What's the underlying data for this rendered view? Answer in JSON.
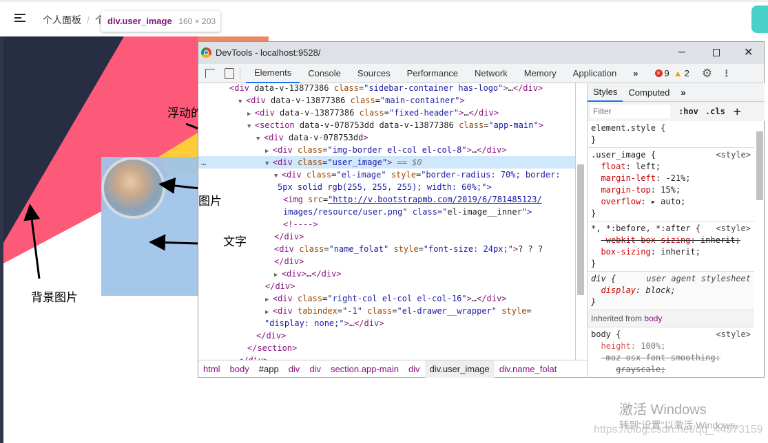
{
  "app": {
    "breadcrumb": [
      "个人面板",
      "个"
    ],
    "tooltip": {
      "selector": "div.user_image",
      "size": "160 × 203"
    }
  },
  "colors": {
    "navy": "#272d43",
    "pink": "#fd5a7a",
    "yellow": "#ffcb3b",
    "orange": "#e8896a",
    "highlight": "#a5c6e9",
    "teal": "#47d1c8"
  },
  "annotations": {
    "float_div": "浮动的div",
    "image": "图片",
    "text": "文字",
    "background": "背景图片"
  },
  "devtools": {
    "title": "DevTools - localhost:9528/",
    "tabs": [
      "Elements",
      "Console",
      "Sources",
      "Performance",
      "Network",
      "Memory",
      "Application"
    ],
    "more": "»",
    "errors": "9",
    "warnings": "2",
    "dom_lines": [
      {
        "indent": 0,
        "tri": "",
        "html": "<div data-v-13877386 class=\"sidebar-container has-logo\">…</div>"
      },
      {
        "indent": 1,
        "tri": "▼",
        "html": "<div data-v-13877386 class=\"main-container\">"
      },
      {
        "indent": 2,
        "tri": "▶",
        "html": "<div data-v-13877386 class=\"fixed-header\">…</div>"
      },
      {
        "indent": 2,
        "tri": "▼",
        "html": "<section data-v-078753dd data-v-13877386 class=\"app-main\">"
      },
      {
        "indent": 3,
        "tri": "▼",
        "html": "<div data-v-078753dd>"
      },
      {
        "indent": 4,
        "tri": "▶",
        "html": "<div class=\"img-border el-col el-col-8\">…</div>"
      },
      {
        "indent": 4,
        "tri": "▼",
        "html": "<div class=\"user_image\"> == $0",
        "selected": true
      },
      {
        "indent": 5,
        "tri": "▼",
        "html": "<div class=\"el-image\" style=\"border-radius: 70%; border:"
      },
      {
        "indent": 5,
        "tri": "",
        "html": "5px solid rgb(255, 255, 255); width: 60%;\">",
        "wrap": true
      },
      {
        "indent": 6,
        "tri": "",
        "html": "<img src=\"http://v.bootstrapmb.com/2019/6/781485123/"
      },
      {
        "indent": 6,
        "tri": "",
        "html": "images/resource/user.png\" class=\"el-image__inner\">"
      },
      {
        "indent": 6,
        "tri": "",
        "html": "<!---->"
      },
      {
        "indent": 5,
        "tri": "",
        "html": "</div>"
      },
      {
        "indent": 5,
        "tri": "",
        "html": "<div class=\"name_folat\" style=\"font-size: 24px;\">? ? ?"
      },
      {
        "indent": 5,
        "tri": "",
        "html": "</div>"
      },
      {
        "indent": 5,
        "tri": "▶",
        "html": "<div>…</div>"
      },
      {
        "indent": 4,
        "tri": "",
        "html": "</div>"
      },
      {
        "indent": 4,
        "tri": "▶",
        "html": "<div class=\"right-col el-col el-col-16\">…</div>"
      },
      {
        "indent": 4,
        "tri": "▶",
        "html": "<div tabindex=\"-1\" class=\"el-drawer__wrapper\" style="
      },
      {
        "indent": 3,
        "tri": "",
        "html": "\"display: none;\">…</div>"
      },
      {
        "indent": 3,
        "tri": "",
        "html": "</div>"
      },
      {
        "indent": 2,
        "tri": "",
        "html": "</section>"
      },
      {
        "indent": 1,
        "tri": "",
        "html": "</div>"
      }
    ],
    "crumbs": [
      "html",
      "body",
      "#app",
      "div",
      "div",
      "section.app-main",
      "div",
      "div.user_image",
      "div.name_folat"
    ],
    "styles": {
      "tab_styles": "Styles",
      "tab_computed": "Computed",
      "filter_placeholder": "Filter",
      "hov": ":hov",
      "cls": ".cls",
      "plus": "+",
      "element_style": "element.style {",
      "close": "}",
      "user_image_sel": ".user_image {",
      "src": "<style>",
      "user_image_props": [
        [
          "float",
          "left;"
        ],
        [
          "margin-left",
          "-21%;"
        ],
        [
          "margin-top",
          "15%;"
        ],
        [
          "overflow",
          "auto;"
        ]
      ],
      "star_sel": "*, *:before, *:after {",
      "star_props": [
        [
          "-webkit-box-sizing",
          "inherit;"
        ],
        [
          "box-sizing",
          "inherit;"
        ]
      ],
      "div_sel": "div {",
      "ua": "user agent stylesheet",
      "div_props": [
        [
          "display",
          "block;"
        ]
      ],
      "inherited": "Inherited from",
      "inherited_from": "body",
      "body_sel": "body {",
      "body_props": [
        [
          "height",
          "100%;"
        ],
        [
          "-moz-osx-font-smoothing:",
          "grayscale;"
        ]
      ]
    }
  },
  "watermark": {
    "line1": "激活 Windows",
    "line2": "转到“设置”以激活 Windows。",
    "url": "https://blog.csdn.net/qq_44973159"
  }
}
